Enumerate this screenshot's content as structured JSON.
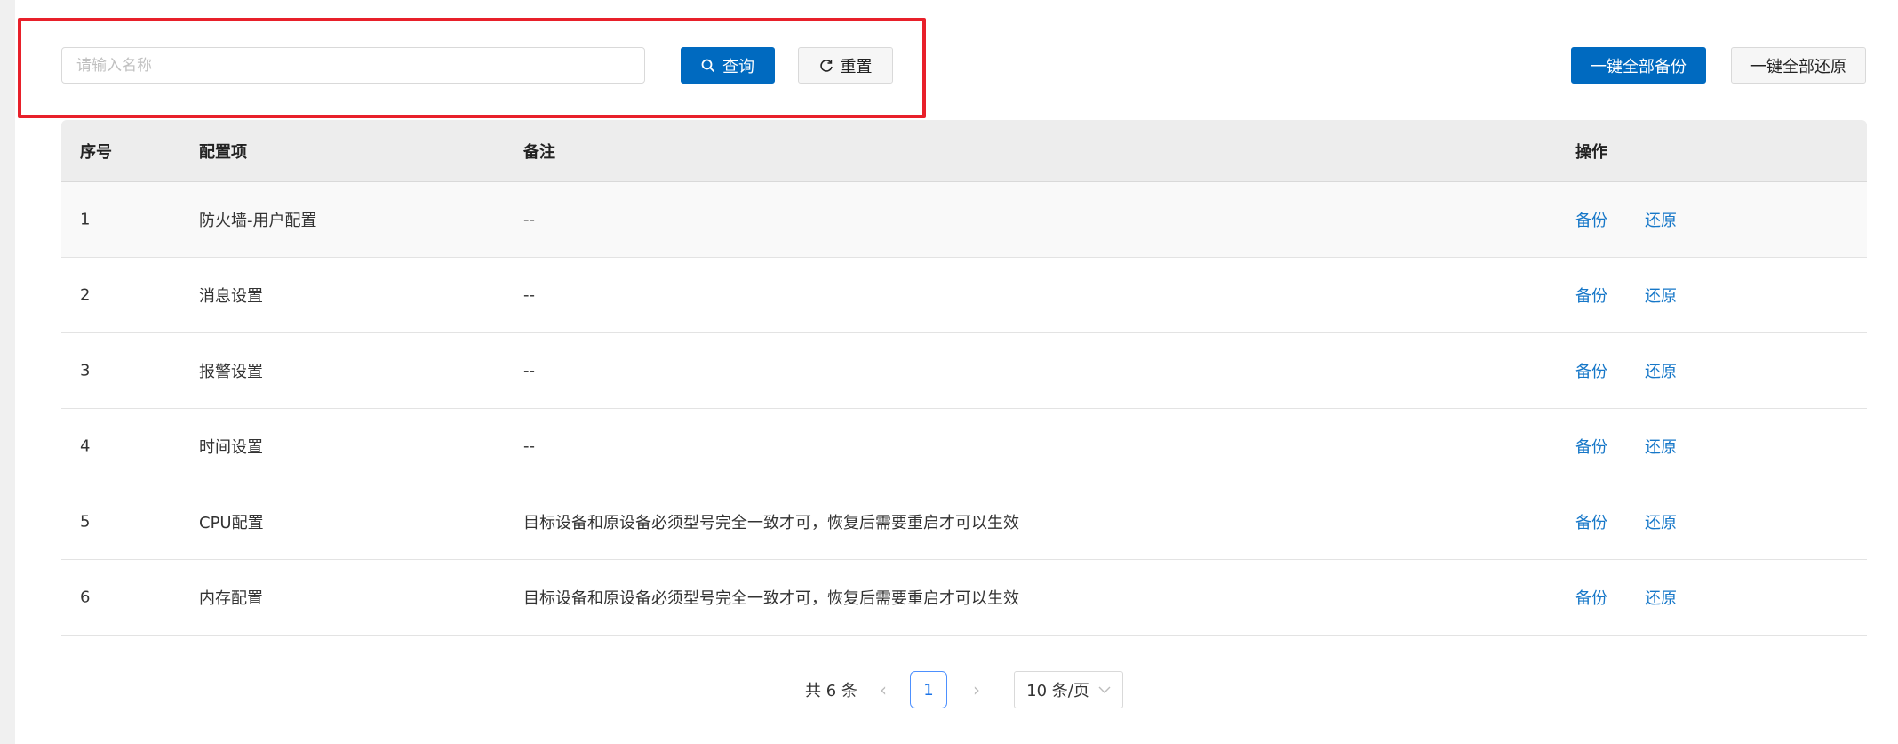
{
  "search": {
    "placeholder": "请输入名称",
    "query_label": "查询",
    "reset_label": "重置"
  },
  "actions": {
    "backup_all": "一键全部备份",
    "restore_all": "一键全部还原"
  },
  "table": {
    "headers": [
      "序号",
      "配置项",
      "备注",
      "操作"
    ],
    "rows": [
      {
        "no": "1",
        "item": "防火墙-用户配置",
        "note": "--",
        "backup": "备份",
        "restore": "还原"
      },
      {
        "no": "2",
        "item": "消息设置",
        "note": "--",
        "backup": "备份",
        "restore": "还原"
      },
      {
        "no": "3",
        "item": "报警设置",
        "note": "--",
        "backup": "备份",
        "restore": "还原"
      },
      {
        "no": "4",
        "item": "时间设置",
        "note": "--",
        "backup": "备份",
        "restore": "还原"
      },
      {
        "no": "5",
        "item": "CPU配置",
        "note": "目标设备和原设备必须型号完全一致才可，恢复后需要重启才可以生效",
        "backup": "备份",
        "restore": "还原"
      },
      {
        "no": "6",
        "item": "内存配置",
        "note": "目标设备和原设备必须型号完全一致才可，恢复后需要重启才可以生效",
        "backup": "备份",
        "restore": "还原"
      }
    ]
  },
  "pagination": {
    "total": "共 6 条",
    "current_page": "1",
    "page_size": "10 条/页"
  },
  "colors": {
    "primary": "#006ac0",
    "highlight": "#e8202a",
    "link": "#1677c8"
  }
}
